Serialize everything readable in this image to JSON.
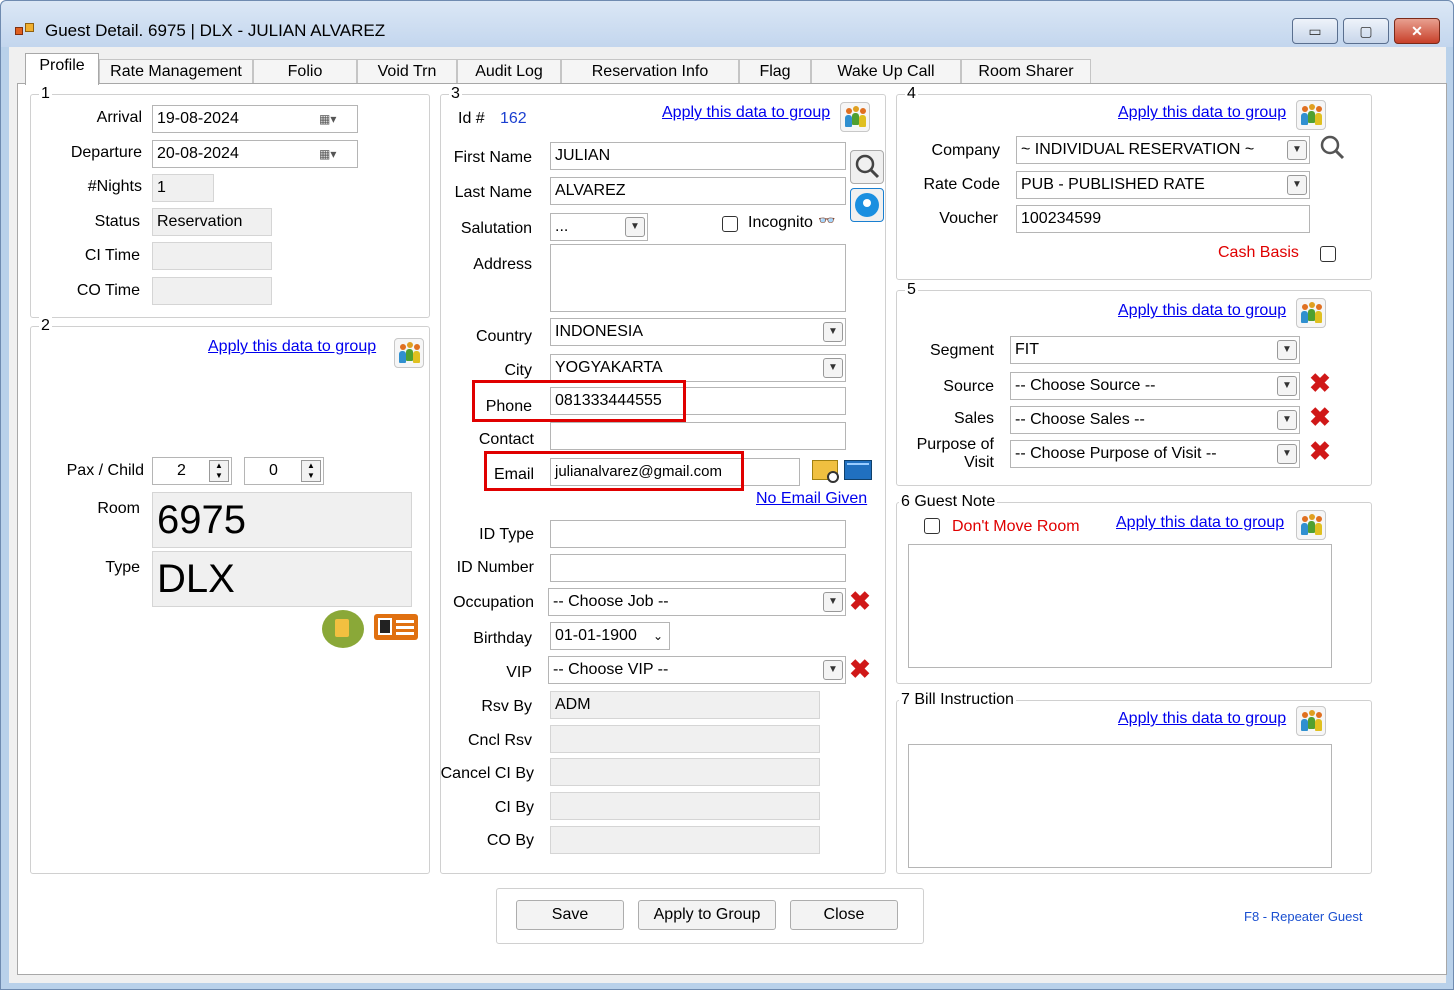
{
  "window": {
    "title": "Guest Detail. 6975 | DLX - JULIAN ALVAREZ",
    "minimize": "▭",
    "maximize": "▢",
    "close": "✕"
  },
  "tabs": [
    "Profile",
    "Rate Management",
    "Folio",
    "Void Trn",
    "Audit Log",
    "Reservation Info",
    "Flag",
    "Wake Up Call",
    "Room Sharer"
  ],
  "group1": {
    "label": "1",
    "arrival_label": "Arrival",
    "arrival": "19-08-2024",
    "departure_label": "Departure",
    "departure": "20-08-2024",
    "nights_label": "#Nights",
    "nights": "1",
    "status_label": "Status",
    "status": "Reservation",
    "ci_time_label": "CI Time",
    "ci_time": "",
    "co_time_label": "CO Time",
    "co_time": ""
  },
  "group2": {
    "label": "2",
    "apply_link": "Apply this data to group",
    "pax_label": "Pax / Child",
    "pax": "2",
    "child": "0",
    "room_label": "Room",
    "room": "6975",
    "type_label": "Type",
    "type": "DLX"
  },
  "group3": {
    "label": "3",
    "id_label": "Id #",
    "id": "162",
    "apply_link": "Apply this data to group",
    "first_name_label": "First Name",
    "first_name": "JULIAN",
    "last_name_label": "Last Name",
    "last_name": "ALVAREZ",
    "salutation_label": "Salutation",
    "salutation": "...",
    "incognito_label": "Incognito",
    "address_label": "Address",
    "address": "",
    "country_label": "Country",
    "country": "INDONESIA",
    "city_label": "City",
    "city": "YOGYAKARTA",
    "phone_label": "Phone",
    "phone": "081333444555",
    "contact_label": "Contact",
    "contact": "",
    "email_label": "Email",
    "email": "julianalvarez@gmail.com",
    "no_email_link": "No Email Given",
    "id_type_label": "ID Type",
    "id_type": "",
    "id_number_label": "ID Number",
    "id_number": "",
    "occupation_label": "Occupation",
    "occupation": "-- Choose Job --",
    "birthday_label": "Birthday",
    "birthday": "01-01-1900",
    "vip_label": "VIP",
    "vip": "-- Choose VIP --",
    "rsv_by_label": "Rsv By",
    "rsv_by": "ADM",
    "cncl_rsv_label": "Cncl Rsv",
    "cncl_rsv": "",
    "cancel_ci_by_label": "Cancel CI By",
    "cancel_ci_by": "",
    "ci_by_label": "CI By",
    "ci_by": "",
    "co_by_label": "CO By",
    "co_by": ""
  },
  "group4": {
    "label": "4",
    "apply_link": "Apply this data to group",
    "company_label": "Company",
    "company": "~ INDIVIDUAL RESERVATION ~",
    "rate_code_label": "Rate Code",
    "rate_code": "PUB - PUBLISHED RATE",
    "voucher_label": "Voucher",
    "voucher": "100234599",
    "cash_basis_label": "Cash Basis"
  },
  "group5": {
    "label": "5",
    "apply_link": "Apply this data to group",
    "segment_label": "Segment",
    "segment": "FIT",
    "source_label": "Source",
    "source": "-- Choose Source --",
    "sales_label": "Sales",
    "sales": "-- Choose Sales --",
    "purpose_label_1": "Purpose of",
    "purpose_label_2": "Visit",
    "purpose": "-- Choose Purpose of Visit --"
  },
  "group6": {
    "label": "6 Guest Note",
    "dont_move_label": "Don't Move Room",
    "apply_link": "Apply this data to group",
    "note": ""
  },
  "group7": {
    "label": "7 Bill Instruction",
    "apply_link": "Apply this data to group",
    "instruction": ""
  },
  "buttons": {
    "save": "Save",
    "apply_group": "Apply to Group",
    "close": "Close"
  },
  "footer_hint": "F8 - Repeater Guest",
  "colors": {
    "link": "#0000ee",
    "red_text": "#e00000",
    "highlight_box": "#e00000",
    "hint": "#1a4fd0"
  }
}
